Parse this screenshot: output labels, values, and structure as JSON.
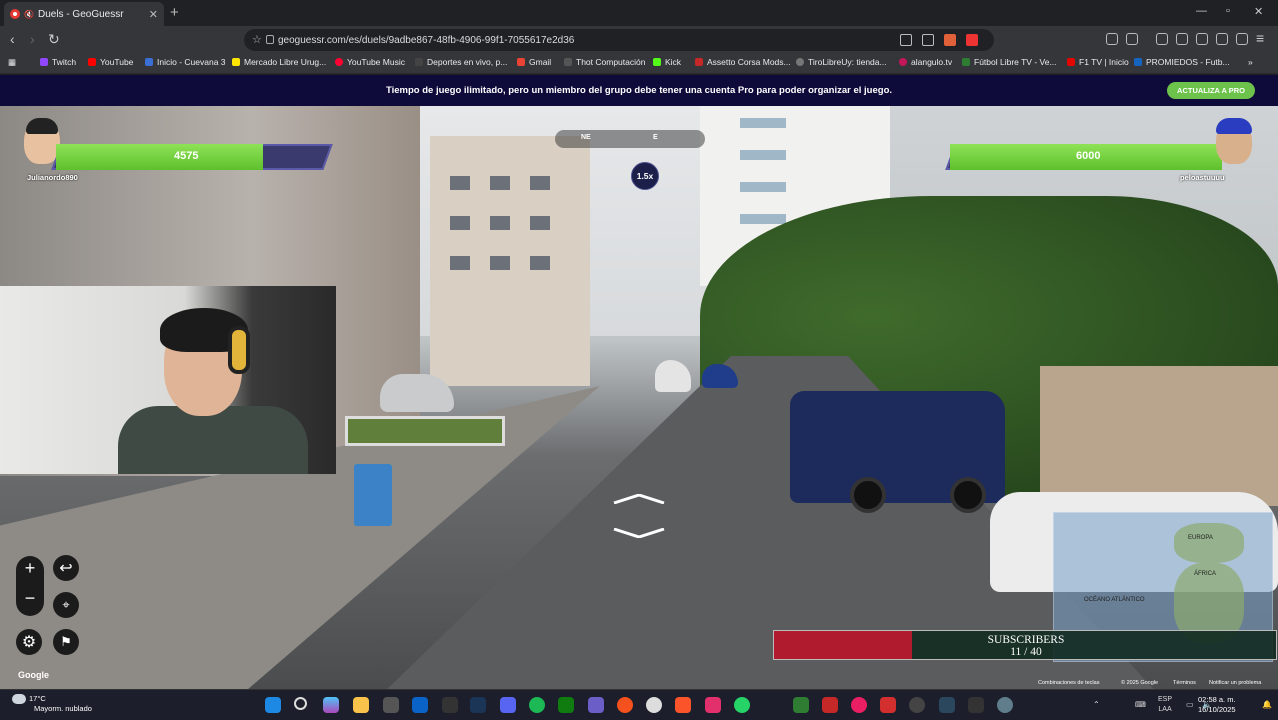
{
  "browser": {
    "tab_title": "Duels - GeoGuessr",
    "url": "geoguessr.com/es/duels/9adbe867-48fb-4906-99f1-7055617e2d36"
  },
  "bookmarks": [
    {
      "label": "Twitch",
      "color": "#9146ff"
    },
    {
      "label": "YouTube",
      "color": "#ff0000"
    },
    {
      "label": "Inicio - Cuevana 3",
      "color": "#3b6fd6"
    },
    {
      "label": "Mercado Libre Urug...",
      "color": "#ffe600"
    },
    {
      "label": "YouTube Music",
      "color": "#ff0033"
    },
    {
      "label": "Deportes en vivo, p...",
      "color": "#444"
    },
    {
      "label": "Gmail",
      "color": "#ea4335"
    },
    {
      "label": "Thot Computación",
      "color": "#555"
    },
    {
      "label": "Kick",
      "color": "#53fc18"
    },
    {
      "label": "Assetto Corsa Mods...",
      "color": "#c62828"
    },
    {
      "label": "TiroLibreUy: tienda...",
      "color": "#777"
    },
    {
      "label": "alangulo.tv",
      "color": "#c2185b"
    },
    {
      "label": "Fútbol Libre TV - Ve...",
      "color": "#2e7d32"
    },
    {
      "label": "F1 TV | Inicio",
      "color": "#e10600"
    },
    {
      "label": "PROMIEDOS - Futb...",
      "color": "#1565c0"
    }
  ],
  "banner": {
    "message": "Tiempo de juego ilimitado, pero un miembro del grupo debe tener una cuenta Pro para poder organizar el juego.",
    "upgrade_label": "ACTUALIZA A PRO",
    "accent_color": "#6cc24a"
  },
  "game": {
    "compass_labels": [
      "NE",
      "E"
    ],
    "zoom_label": "1.5x",
    "player_left": {
      "name": "Julianordo890",
      "health": 4575,
      "health_fraction": 0.76
    },
    "player_right": {
      "name": "peloastuuuu",
      "health": 6000,
      "health_fraction": 1.0
    },
    "google_label": "Google",
    "subscribers": {
      "title": "SUBSCRIBERS",
      "count": "11 / 40",
      "fraction": 0.275,
      "color": "#b01c2e"
    },
    "map_labels": [
      "EUROPA",
      "ÁFRICA",
      "OCÉANO ATLÁNTICO"
    ],
    "legal": [
      "Combinaciones de teclas",
      "© 2025 Google",
      "Términos",
      "Notificar un problema"
    ]
  },
  "taskbar": {
    "temperature": "17°C",
    "weather": "Mayorm. nublado",
    "language": "ESP",
    "layout": "LAA",
    "time": "02:58 a. m.",
    "date": "16/10/2025"
  }
}
